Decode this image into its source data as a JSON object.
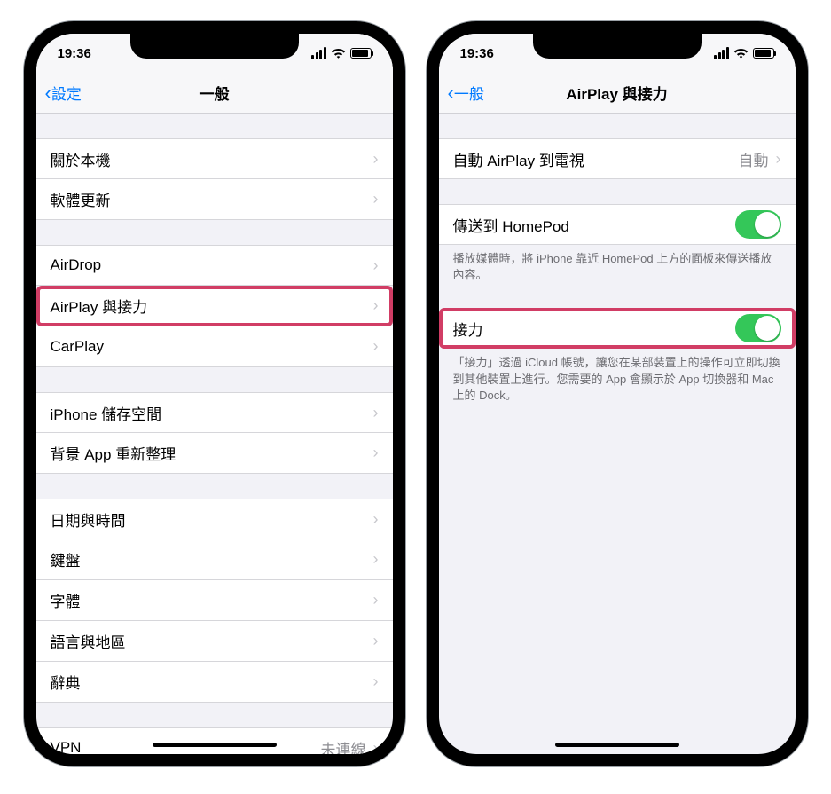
{
  "status": {
    "time": "19:36"
  },
  "left": {
    "back": "設定",
    "title": "一般",
    "groups": [
      {
        "rows": [
          {
            "label": "關於本機",
            "chevron": true
          },
          {
            "label": "軟體更新",
            "chevron": true
          }
        ]
      },
      {
        "rows": [
          {
            "label": "AirDrop",
            "chevron": true
          },
          {
            "label": "AirPlay 與接力",
            "chevron": true,
            "highlight": true
          },
          {
            "label": "CarPlay",
            "chevron": true
          }
        ]
      },
      {
        "rows": [
          {
            "label": "iPhone 儲存空間",
            "chevron": true
          },
          {
            "label": "背景 App 重新整理",
            "chevron": true
          }
        ]
      },
      {
        "rows": [
          {
            "label": "日期與時間",
            "chevron": true
          },
          {
            "label": "鍵盤",
            "chevron": true
          },
          {
            "label": "字體",
            "chevron": true
          },
          {
            "label": "語言與地區",
            "chevron": true
          },
          {
            "label": "辭典",
            "chevron": true
          }
        ]
      },
      {
        "rows": [
          {
            "label": "VPN",
            "detail": "未連線",
            "chevron": true
          }
        ]
      }
    ]
  },
  "right": {
    "back": "一般",
    "title": "AirPlay 與接力",
    "group1": {
      "label": "自動 AirPlay 到電視",
      "detail": "自動"
    },
    "group2": {
      "label": "傳送到 HomePod",
      "footer": "播放媒體時，將 iPhone 靠近 HomePod 上方的面板來傳送播放內容。"
    },
    "group3": {
      "label": "接力",
      "footer": "「接力」透過 iCloud 帳號，讓您在某部裝置上的操作可立即切換到其他裝置上進行。您需要的 App 會顯示於 App 切換器和 Mac 上的 Dock。"
    }
  }
}
